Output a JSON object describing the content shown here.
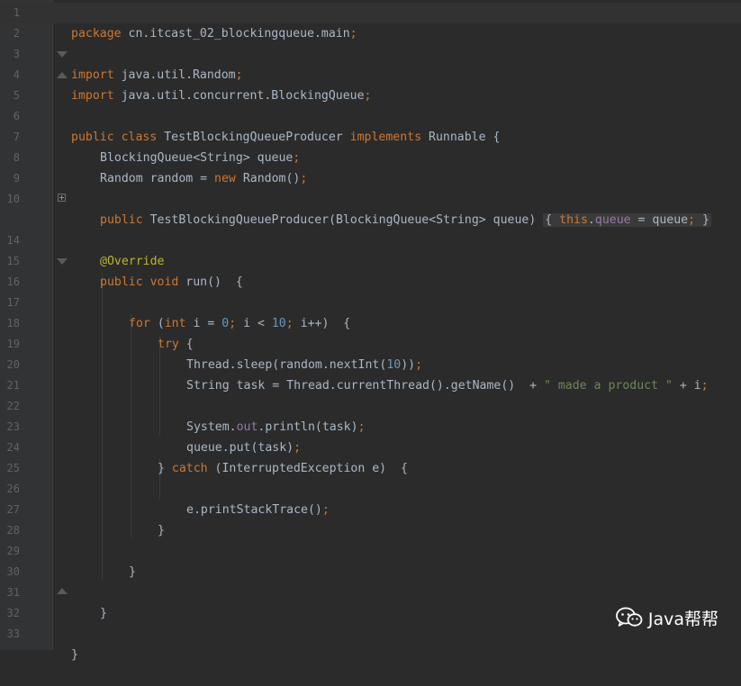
{
  "editor": {
    "theme_colors": {
      "background": "#2b2b2b",
      "gutter": "#313335",
      "keyword": "#cc7832",
      "number": "#6897bb",
      "string": "#6a8759",
      "annotation": "#bbb529",
      "field": "#9876aa",
      "text": "#a9b7c6",
      "line_number": "#606366"
    },
    "line_numbers": [
      "1",
      "2",
      "3",
      "4",
      "5",
      "6",
      "7",
      "8",
      "9",
      "10",
      "14",
      "15",
      "16",
      "17",
      "18",
      "19",
      "20",
      "21",
      "22",
      "23",
      "24",
      "25",
      "26",
      "27",
      "28",
      "29",
      "30",
      "31",
      "32",
      "33"
    ],
    "lines": {
      "l1": {
        "kw": "package",
        "rest": " cn.itcast_02_blockingqueue.main",
        "end": ";"
      },
      "l3": {
        "kw": "import",
        "rest": " java.util.Random",
        "end": ";"
      },
      "l4": {
        "kw": "import",
        "rest": " java.util.concurrent.BlockingQueue",
        "end": ";"
      },
      "l6": {
        "kw1": "public class",
        "name": " TestBlockingQueueProducer ",
        "kw2": "implements",
        "rest": " Runnable {"
      },
      "l7": {
        "text": "BlockingQueue<String> queue",
        "end": ";"
      },
      "l8": {
        "text1": "Random random = ",
        "kw": "new",
        "text2": " Random()",
        "end": ";"
      },
      "l10": {
        "kw": "public",
        "text": " TestBlockingQueueProducer(BlockingQueue<String> queue) ",
        "fold_open": "{ ",
        "kw2": "this",
        "text2": ".",
        "field": "queue",
        "text3": " = queue",
        "end": ";",
        "fold_close": " }"
      },
      "l14": {
        "annotation": "@Override"
      },
      "l15": {
        "kw": "public void",
        "text": " run()  {"
      },
      "l17": {
        "kw": "for",
        "text1": " (",
        "kw2": "int",
        "text2": " i = ",
        "n1": "0",
        "sep1": ";",
        "text3": " i < ",
        "n2": "10",
        "sep2": ";",
        "text4": " i++)  {"
      },
      "l18": {
        "kw": "try",
        "text": " {"
      },
      "l19": {
        "text": "Thread.sleep(random.nextInt(",
        "num": "10",
        "text2": "))",
        "end": ";"
      },
      "l20": {
        "text": "String task = Thread.currentThread().getName()  + ",
        "str": "\" made a product \"",
        "text2": " + i",
        "end": ";"
      },
      "l22": {
        "text1": "System.",
        "field": "out",
        "text2": ".println(task)",
        "end": ";"
      },
      "l23": {
        "text": "queue.put(task)",
        "end": ";"
      },
      "l24": {
        "text1": "} ",
        "kw": "catch",
        "text2": " (InterruptedException e)  {"
      },
      "l26": {
        "text": "e.printStackTrace()",
        "end": ";"
      },
      "l27": {
        "text": "}"
      },
      "l29": {
        "text": "}"
      },
      "l31": {
        "text": "}"
      },
      "l33": {
        "text": "}"
      }
    }
  },
  "watermark": {
    "icon": "wechat-icon",
    "text": "Java帮帮"
  }
}
